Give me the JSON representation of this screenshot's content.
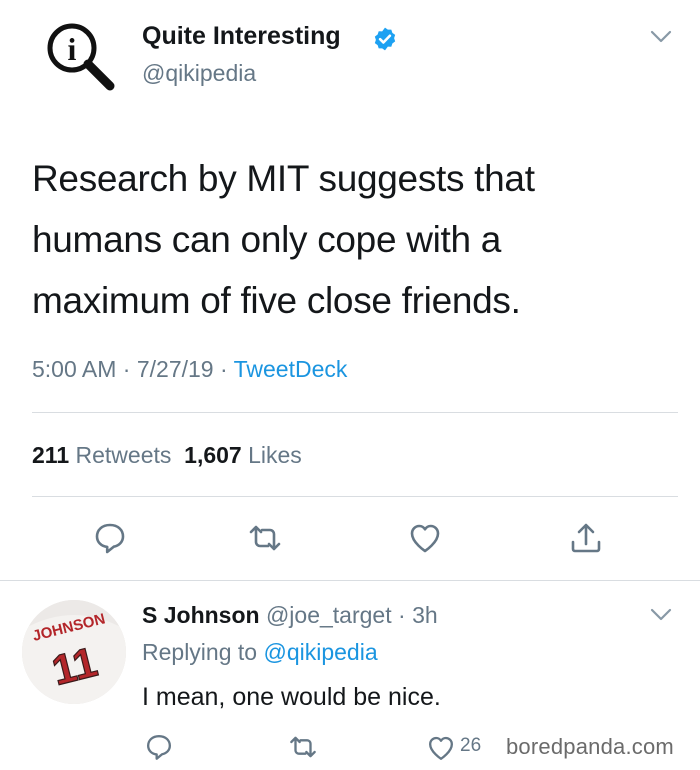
{
  "tweet": {
    "author_name": "Quite Interesting",
    "author_handle": "@qikipedia",
    "text": "Research by MIT suggests that humans can only cope with a maximum of five close friends.",
    "time": "5:00 AM",
    "date": "7/27/19",
    "source": "TweetDeck",
    "retweets_count": "211",
    "retweets_label": "Retweets",
    "likes_count": "1,607",
    "likes_label": "Likes"
  },
  "reply": {
    "author_name": "S Johnson",
    "author_handle": "@joe_target",
    "age": "3h",
    "replying_prefix": "Replying to",
    "replying_to": "@qikipedia",
    "text": "I mean, one would be nice.",
    "like_count": "26",
    "avatar_text": "JOHNSON",
    "avatar_number": "11"
  },
  "watermark": "boredpanda.com",
  "colors": {
    "link": "#1b95e0",
    "muted": "#657786",
    "verified": "#1da1f2",
    "divider": "#d9dde1"
  },
  "icons": [
    "quite-interesting-logo",
    "verified-badge-icon",
    "chevron-down-icon",
    "reply-icon",
    "retweet-icon",
    "like-icon",
    "share-icon"
  ]
}
